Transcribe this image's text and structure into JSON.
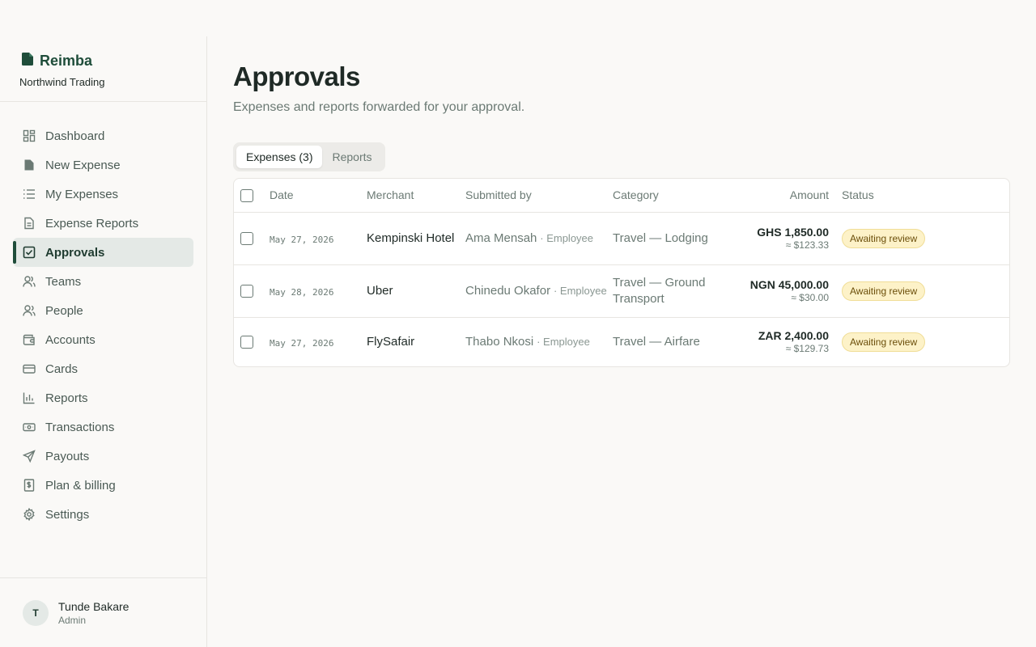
{
  "brand": {
    "name": "Reimba",
    "org": "Northwind Trading"
  },
  "nav": [
    {
      "label": "Dashboard",
      "icon": "dashboard-icon",
      "active": false
    },
    {
      "label": "New Expense",
      "icon": "file-icon",
      "active": false
    },
    {
      "label": "My Expenses",
      "icon": "list-icon",
      "active": false
    },
    {
      "label": "Expense Reports",
      "icon": "report-icon",
      "active": false
    },
    {
      "label": "Approvals",
      "icon": "check-square-icon",
      "active": true
    },
    {
      "label": "Teams",
      "icon": "team-icon",
      "active": false
    },
    {
      "label": "People",
      "icon": "people-icon",
      "active": false
    },
    {
      "label": "Accounts",
      "icon": "wallet-icon",
      "active": false
    },
    {
      "label": "Cards",
      "icon": "card-icon",
      "active": false
    },
    {
      "label": "Reports",
      "icon": "bar-chart-icon",
      "active": false
    },
    {
      "label": "Transactions",
      "icon": "banknote-icon",
      "active": false
    },
    {
      "label": "Payouts",
      "icon": "send-icon",
      "active": false
    },
    {
      "label": "Plan & billing",
      "icon": "receipt-icon",
      "active": false
    },
    {
      "label": "Settings",
      "icon": "gear-icon",
      "active": false
    }
  ],
  "user": {
    "initial": "T",
    "name": "Tunde Bakare",
    "role": "Admin"
  },
  "page": {
    "title": "Approvals",
    "subtitle": "Expenses and reports forwarded for your approval."
  },
  "tabs": [
    {
      "label": "Expenses (3)",
      "active": true
    },
    {
      "label": "Reports",
      "active": false
    }
  ],
  "table": {
    "headers": {
      "date": "Date",
      "merchant": "Merchant",
      "submitted_by": "Submitted by",
      "category": "Category",
      "amount": "Amount",
      "status": "Status"
    },
    "rows": [
      {
        "date": "May 27, 2026",
        "merchant": "Kempinski Hotel",
        "submitter": "Ama Mensah",
        "role": "· Employee",
        "category": "Travel — Lodging",
        "amount": "GHS 1,850.00",
        "amount_usd": "≈ $123.33",
        "status": "Awaiting review"
      },
      {
        "date": "May 28, 2026",
        "merchant": "Uber",
        "submitter": "Chinedu Okafor",
        "role": "· Employee",
        "category": "Travel — Ground Transport",
        "amount": "NGN 45,000.00",
        "amount_usd": "≈ $30.00",
        "status": "Awaiting review"
      },
      {
        "date": "May 27, 2026",
        "merchant": "FlySafair",
        "submitter": "Thabo Nkosi",
        "role": "· Employee",
        "category": "Travel — Airfare",
        "amount": "ZAR 2,400.00",
        "amount_usd": "≈ $129.73",
        "status": "Awaiting review"
      }
    ]
  },
  "colors": {
    "brand": "#1f4d3a",
    "badge_bg": "#fdf2c8",
    "badge_text": "#6b4e0a"
  }
}
